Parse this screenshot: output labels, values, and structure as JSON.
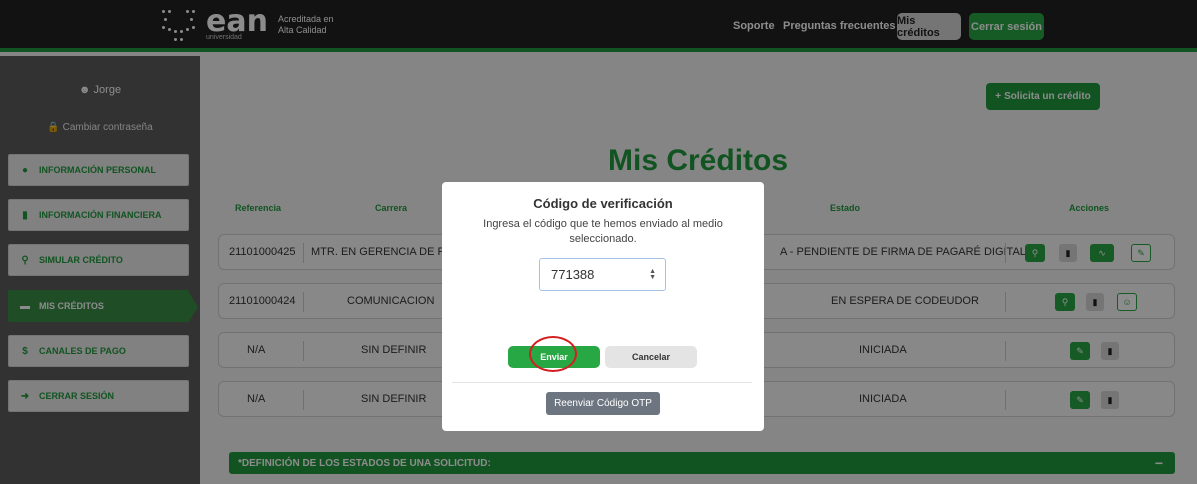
{
  "brand": {
    "name": "ean",
    "sub": "universidad",
    "tagline_1": "Acreditada en",
    "tagline_2": "Alta Calidad"
  },
  "topnav": {
    "soporte": "Soporte",
    "faq": "Preguntas frecuentes",
    "mis_creditos": "Mis créditos",
    "cerrar_sesion": "Cerrar sesión"
  },
  "sidebar": {
    "user": "Jorge",
    "change_password": "Cambiar contraseña",
    "items": [
      {
        "label": "INFORMACIÓN PERSONAL",
        "icon": "user-icon"
      },
      {
        "label": "INFORMACIÓN FINANCIERA",
        "icon": "file-icon"
      },
      {
        "label": "SIMULAR CRÉDITO",
        "icon": "search-icon"
      },
      {
        "label": "MIS CRÉDITOS",
        "icon": "card-icon",
        "active": true
      },
      {
        "label": "CANALES DE PAGO",
        "icon": "dollar-icon"
      },
      {
        "label": "CERRAR SESIÓN",
        "icon": "logout-icon"
      }
    ]
  },
  "main": {
    "solicita_button": "Solicita un crédito",
    "title": "Mis Créditos",
    "headers": {
      "referencia": "Referencia",
      "carrera": "Carrera",
      "estado": "Estado",
      "acciones": "Acciones"
    },
    "rows": [
      {
        "referencia": "21101000425",
        "carrera": "MTR. EN GERENCIA DE PROY",
        "estado": "A - PENDIENTE DE FIRMA DE PAGARÉ DIGITAL"
      },
      {
        "referencia": "21101000424",
        "carrera": "COMUNICACION",
        "estado": "EN ESPERA DE CODEUDOR"
      },
      {
        "referencia": "N/A",
        "carrera": "SIN DEFINIR",
        "estado": "INICIADA"
      },
      {
        "referencia": "N/A",
        "carrera": "SIN DEFINIR",
        "estado": "INICIADA"
      }
    ],
    "definitions_bar": "*DEFINICIÓN DE LOS ESTADOS DE UNA SOLICITUD:",
    "definitions_toggle": "−"
  },
  "modal": {
    "title": "Código de verificación",
    "text": "Ingresa el código que te hemos enviado al medio seleccionado.",
    "code_value": "771388",
    "enviar": "Enviar",
    "cancelar": "Cancelar",
    "reenviar": "Reenviar Código OTP"
  },
  "colors": {
    "brand_green": "#1f9a3c",
    "button_green": "#28a745",
    "topbar": "#222222",
    "sidebar": "#5c5c5c",
    "highlight_ring": "#d21f1f"
  }
}
